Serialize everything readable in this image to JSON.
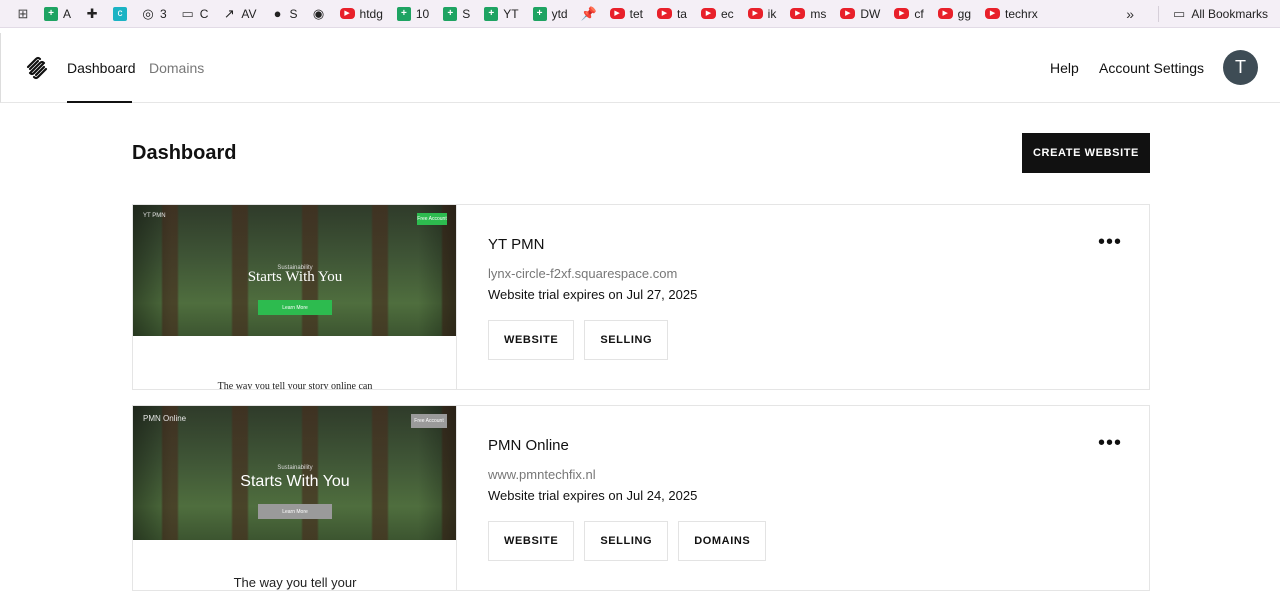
{
  "bookmarks": {
    "items": [
      {
        "label": "",
        "icon": "apps-grid-icon"
      },
      {
        "label": "A",
        "icon": "sheets-icon"
      },
      {
        "label": "",
        "icon": "puzzle-extension-icon"
      },
      {
        "label": "",
        "icon": "canva-icon"
      },
      {
        "label": "3",
        "icon": "openai-icon"
      },
      {
        "label": "C",
        "icon": "folder-icon"
      },
      {
        "label": "AV",
        "icon": "trend-chart-icon"
      },
      {
        "label": "S",
        "icon": "globe-icon"
      },
      {
        "label": "",
        "icon": "github-icon"
      },
      {
        "label": "htdg",
        "icon": "youtube-icon"
      },
      {
        "label": "10",
        "icon": "sheets-icon"
      },
      {
        "label": "S",
        "icon": "sheets-icon"
      },
      {
        "label": "YT",
        "icon": "sheets-icon"
      },
      {
        "label": "ytd",
        "icon": "sheets-icon"
      },
      {
        "label": "",
        "icon": "pin-icon"
      },
      {
        "label": "tet",
        "icon": "youtube-icon"
      },
      {
        "label": "ta",
        "icon": "youtube-icon"
      },
      {
        "label": "ec",
        "icon": "youtube-icon"
      },
      {
        "label": "ik",
        "icon": "youtube-icon"
      },
      {
        "label": "ms",
        "icon": "youtube-icon"
      },
      {
        "label": "DW",
        "icon": "youtube-icon"
      },
      {
        "label": "cf",
        "icon": "youtube-icon"
      },
      {
        "label": "gg",
        "icon": "youtube-icon"
      },
      {
        "label": "techrx",
        "icon": "youtube-icon"
      }
    ],
    "more": "»",
    "all_bookmarks": "All Bookmarks"
  },
  "nav": {
    "tabs": [
      "Dashboard",
      "Domains"
    ],
    "help": "Help",
    "account": "Account Settings",
    "avatar_initial": "T"
  },
  "page": {
    "title": "Dashboard",
    "create_button": "CREATE WEBSITE"
  },
  "sites": [
    {
      "name": "YT PMN",
      "url": "lynx-circle-f2xf.squarespace.com",
      "trial": "Website trial expires on Jul 27, 2025",
      "buttons": [
        "WEBSITE",
        "SELLING"
      ],
      "thumb": {
        "nav": "YT PMN",
        "badge": "Free Account",
        "sub": "Sustainability",
        "hero": "Starts With You",
        "cta": "Learn More",
        "caption": "The way you tell your story online can"
      }
    },
    {
      "name": "PMN Online",
      "url": "www.pmntechfix.nl",
      "trial": "Website trial expires on Jul 24, 2025",
      "buttons": [
        "WEBSITE",
        "SELLING",
        "DOMAINS"
      ],
      "thumb": {
        "nav": "PMN Online",
        "badge": "Free Account",
        "sub": "Sustainability",
        "hero": "Starts With You",
        "cta": "Learn More",
        "caption": "The way you tell your"
      }
    }
  ],
  "colors": {
    "accent_green": "#2dbb4f",
    "button_dark": "#111111",
    "avatar_bg": "#3e4c55"
  }
}
